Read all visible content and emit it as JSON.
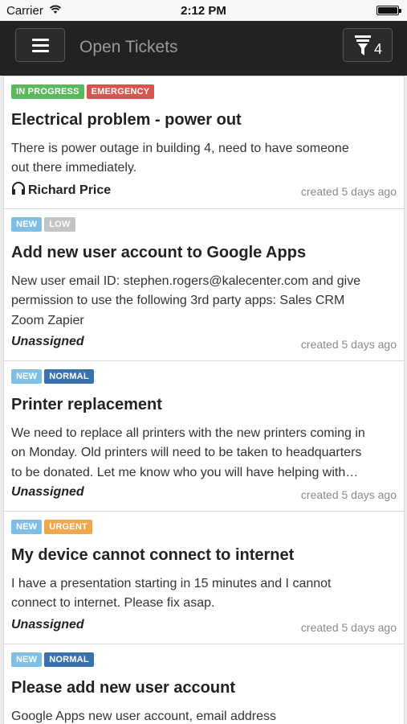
{
  "status_bar": {
    "carrier": "Carrier",
    "time": "2:12 PM",
    "battery_level": 1.0
  },
  "navbar": {
    "title": "Open Tickets",
    "filter_count": "4",
    "menu_icon": "hamburger-icon",
    "filter_icon": "filter-funnel-icon"
  },
  "colors": {
    "in_progress": "#5cb85c",
    "emergency": "#d9534f",
    "new": "#5bc0de",
    "low": "#bbbbbb",
    "normal": "#337ab7",
    "urgent": "#f0ad4e",
    "navbar": "#222222"
  },
  "tickets": [
    {
      "badges": [
        {
          "label": "IN PROGRESS",
          "color": "#5cb85c"
        },
        {
          "label": "EMERGENCY",
          "color": "#d9534f"
        }
      ],
      "title": "Electrical problem - power out",
      "description": [
        "There is power outage in building 4, need to have someone",
        "out there immediately."
      ],
      "assignee": "Richard Price",
      "assignee_icon": "headset-icon",
      "created": "created 5 days ago"
    },
    {
      "badges": [
        {
          "label": "NEW",
          "color": "#7fbfe6"
        },
        {
          "label": "LOW",
          "color": "#c4c4c4"
        }
      ],
      "title": "Add new user account to Google Apps",
      "description": [
        "New user email ID: stephen.rogers@kalecenter.com and give",
        "permission to use the following 3rd party apps: Sales CRM",
        "Zoom Zapier"
      ],
      "assignee": "Unassigned",
      "created": "created 5 days ago"
    },
    {
      "badges": [
        {
          "label": "NEW",
          "color": "#7fbfe6"
        },
        {
          "label": "NORMAL",
          "color": "#3a73ac"
        }
      ],
      "title": "Printer replacement",
      "description": [
        "We need to replace all printers with the new printers coming in",
        "on Monday. Old printers will need to be taken to headquarters",
        "to be donated.   Let me know who you will have helping with…"
      ],
      "assignee": "Unassigned",
      "created": "created 5 days ago"
    },
    {
      "badges": [
        {
          "label": "NEW",
          "color": "#7fbfe6"
        },
        {
          "label": "URGENT",
          "color": "#efa94a"
        }
      ],
      "title": "My device cannot connect to internet",
      "description": [
        "I have a presentation starting in 15 minutes and I cannot",
        "connect to internet. Please fix asap."
      ],
      "assignee": "Unassigned",
      "created": "created 5 days ago"
    },
    {
      "badges": [
        {
          "label": "NEW",
          "color": "#7fbfe6"
        },
        {
          "label": "NORMAL",
          "color": "#3a73ac"
        }
      ],
      "title": "Please add new user account",
      "description": [
        "Google Apps new user account, email address"
      ],
      "assignee": "",
      "created": ""
    }
  ]
}
